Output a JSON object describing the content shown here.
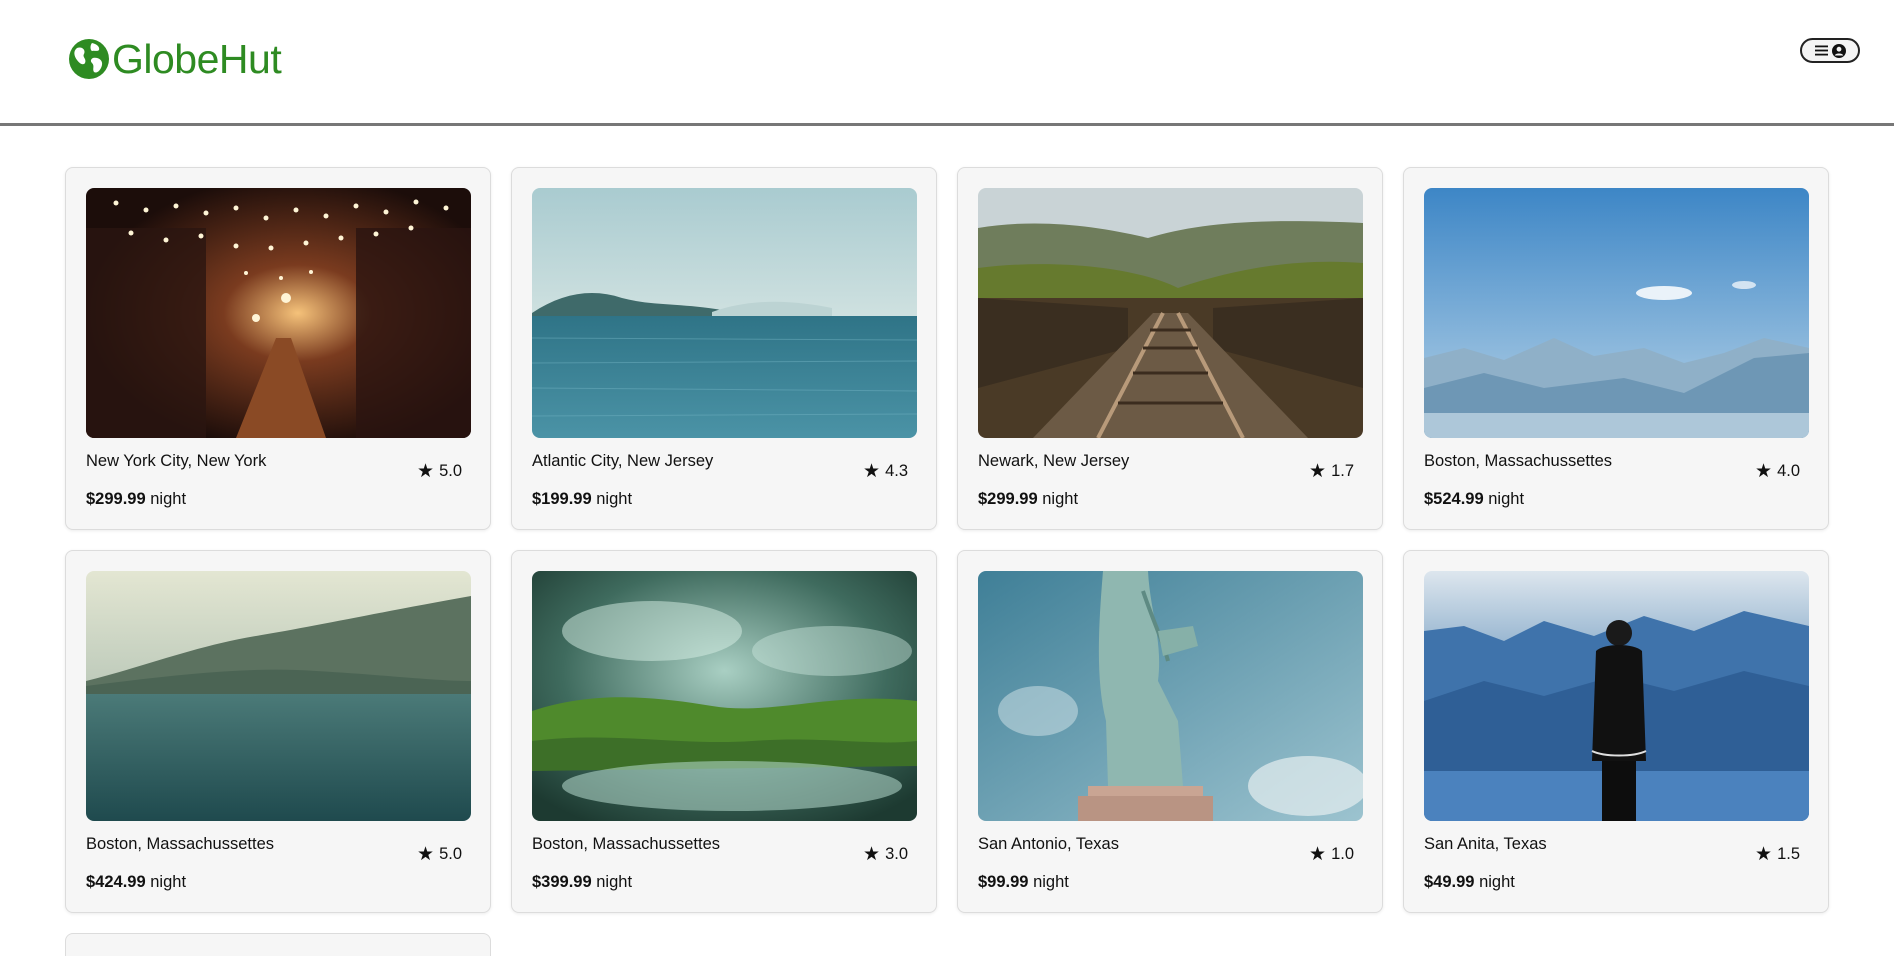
{
  "brand": {
    "name": "GlobeHut",
    "color": "#2e8b22"
  },
  "header": {
    "menu_icons": [
      "menu-icon",
      "user-circle-icon"
    ]
  },
  "listings": [
    {
      "location": "New York City, New York",
      "rating": "5.0",
      "price": "$299.99",
      "unit": "night"
    },
    {
      "location": "Atlantic City, New Jersey",
      "rating": "4.3",
      "price": "$199.99",
      "unit": "night"
    },
    {
      "location": "Newark, New Jersey",
      "rating": "1.7",
      "price": "$299.99",
      "unit": "night"
    },
    {
      "location": "Boston, Massachussettes",
      "rating": "4.0",
      "price": "$524.99",
      "unit": "night"
    },
    {
      "location": "Boston, Massachussettes",
      "rating": "5.0",
      "price": "$424.99",
      "unit": "night"
    },
    {
      "location": "Boston, Massachussettes",
      "rating": "3.0",
      "price": "$399.99",
      "unit": "night"
    },
    {
      "location": "San Antonio, Texas",
      "rating": "1.0",
      "price": "$99.99",
      "unit": "night"
    },
    {
      "location": "San Anita, Texas",
      "rating": "1.5",
      "price": "$49.99",
      "unit": "night"
    }
  ]
}
